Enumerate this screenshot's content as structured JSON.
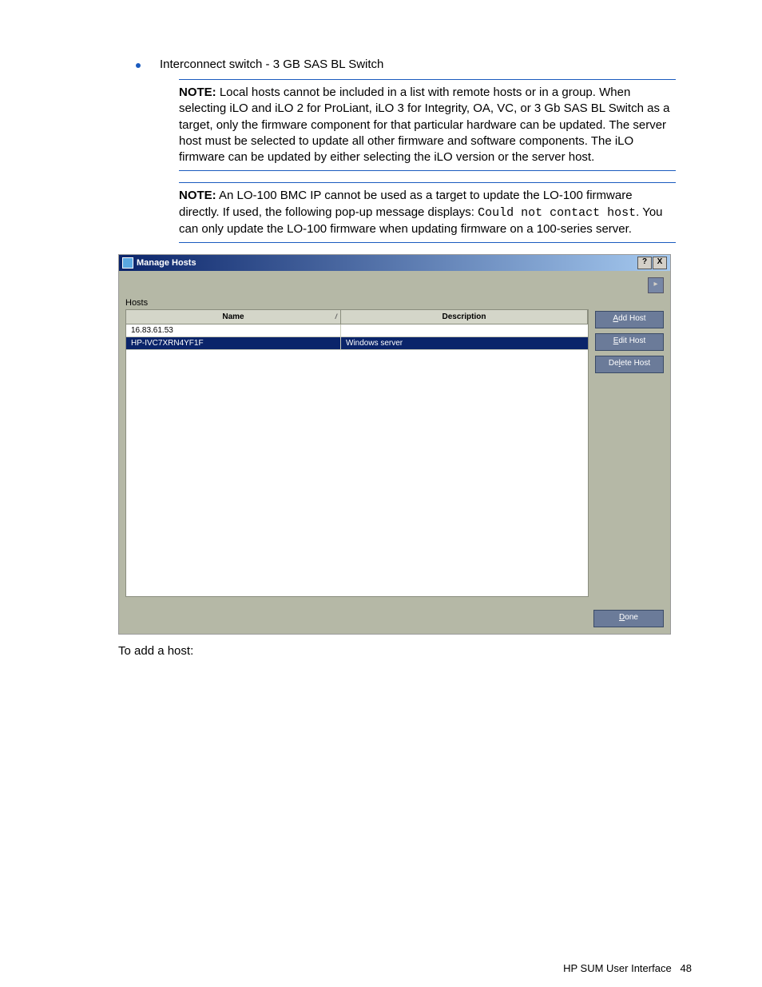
{
  "bullet": "Interconnect switch - 3 GB SAS BL Switch",
  "note1": {
    "label": "NOTE:",
    "text": " Local hosts cannot be included in a list with remote hosts or in a group. When selecting iLO and iLO 2 for ProLiant, iLO 3 for Integrity, OA, VC, or 3 Gb SAS BL Switch as a target, only the firmware component for that particular hardware can be updated. The server host must be selected to update all other firmware and software components. The iLO firmware can be updated by either selecting the iLO version or the server host."
  },
  "note2": {
    "label": "NOTE:",
    "pre": " An LO-100 BMC IP cannot be used as a target to update the LO-100 firmware directly. If used, the following pop-up message displays: ",
    "mono": "Could not contact host",
    "post": ". You can only update the LO-100 firmware when updating firmware on a 100-series server."
  },
  "dialog": {
    "title": "Manage Hosts",
    "help": "?",
    "close": "X",
    "toolbar_square": "▸",
    "hosts_label": "Hosts",
    "col_name": "Name",
    "col_desc": "Description",
    "rows": [
      {
        "name": "16.83.61.53",
        "desc": "",
        "selected": false
      },
      {
        "name": "HP-IVC7XRN4YF1F",
        "desc": "Windows server",
        "selected": true
      }
    ],
    "btn_add": "Add Host",
    "btn_edit": "Edit Host",
    "btn_delete": "Delete Host",
    "btn_done": "Done"
  },
  "after_ss": "To add a host:",
  "footer_text": "HP SUM User Interface",
  "footer_page": "48"
}
